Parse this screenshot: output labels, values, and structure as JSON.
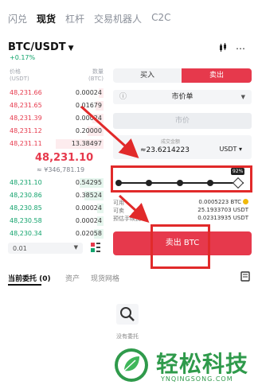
{
  "top_tabs": [
    "闪兑",
    "现货",
    "杠杆",
    "交易机器人",
    "C2C"
  ],
  "active_tab": "现货",
  "pair": "BTC/USDT",
  "change": "+0.17%",
  "orderbook": {
    "price_header": "价格\n(USDT)",
    "qty_header": "数量\n(BTC)",
    "asks": [
      {
        "price": "48,231.66",
        "qty": "0.00024"
      },
      {
        "price": "48,231.65",
        "qty": "0.01679"
      },
      {
        "price": "48,231.39",
        "qty": "0.00024"
      },
      {
        "price": "48,231.12",
        "qty": "0.20000"
      },
      {
        "price": "48,231.11",
        "qty": "13.38497"
      }
    ],
    "last_price": "48,231.10",
    "last_price_cny": "≈ ¥346,781.19",
    "bids": [
      {
        "price": "48,231.10",
        "qty": "0.54295"
      },
      {
        "price": "48,230.86",
        "qty": "0.38524"
      },
      {
        "price": "48,230.85",
        "qty": "0.00024"
      },
      {
        "price": "48,230.58",
        "qty": "0.00024"
      },
      {
        "price": "48,230.34",
        "qty": "0.02058"
      }
    ],
    "precision": "0.01"
  },
  "trade": {
    "buy_label": "买入",
    "sell_label": "卖出",
    "order_type": "市价单",
    "price_placeholder": "市价",
    "amount_label": "成交金额",
    "amount_value": "≈23.6214223",
    "amount_currency": "USDT",
    "slider_percent_label": "92%",
    "slider_fraction": 0.92,
    "info": [
      {
        "key": "可用",
        "value": "0.0005223 BTC"
      },
      {
        "key": "可卖",
        "value": "25.1933703 USDT"
      },
      {
        "key": "预估手续费",
        "value": "0.02313935 USDT"
      }
    ],
    "sell_button": "卖出 BTC"
  },
  "bottom": {
    "tab_current": "当前委托 (0)",
    "tab_assets": "资产",
    "tab_grid": "现货网格",
    "empty_text": "没有委托"
  },
  "watermark": {
    "brand": "轻松科技",
    "url": "YNQINGSONG.COM"
  },
  "colors": {
    "sell": "#e6394c",
    "buy": "#12a36c",
    "annotation": "#e12a2a"
  }
}
